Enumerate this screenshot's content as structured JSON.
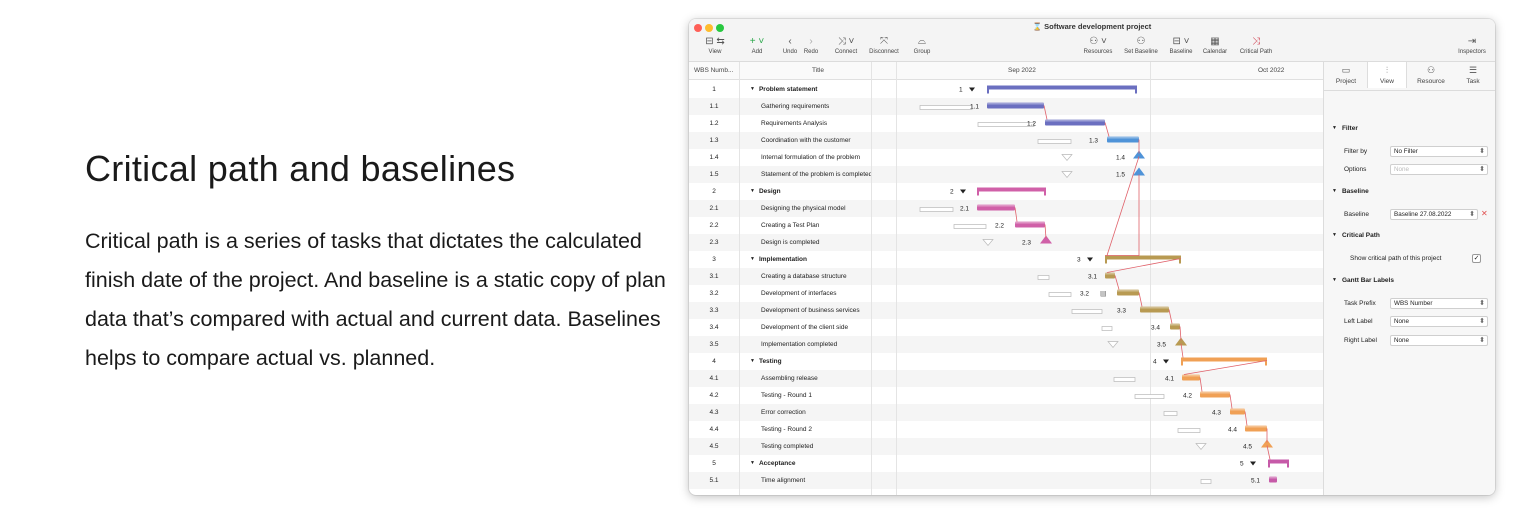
{
  "hero": {
    "title": "Critical path and baselines",
    "body": "Critical path is a series of tasks that dictates the calculated finish date of the project. And baseline is a static copy of plan data that’s compared with actual and current data. Baselines helps to compare actual vs. planned."
  },
  "window": {
    "title": "Software development project",
    "toolbar": {
      "view": "View",
      "add": "Add",
      "undo": "Undo",
      "redo": "Redo",
      "connect": "Connect",
      "disconnect": "Disconnect",
      "group": "Group",
      "resources": "Resources",
      "set_baseline": "Set Baseline",
      "baseline": "Baseline",
      "calendar": "Calendar",
      "critical_path": "Critical Path",
      "inspectors": "Inspectors"
    }
  },
  "grid": {
    "col_wbs": "WBS Numb...",
    "col_title": "Title",
    "months": [
      "Sep 2022",
      "Oct 2022"
    ],
    "rows": [
      {
        "wbs": "1",
        "title": "Problem statement",
        "group": true
      },
      {
        "wbs": "1.1",
        "title": "Gathering requirements",
        "group": false
      },
      {
        "wbs": "1.2",
        "title": "Requirements Analysis",
        "group": false
      },
      {
        "wbs": "1.3",
        "title": "Coordination with the customer",
        "group": false
      },
      {
        "wbs": "1.4",
        "title": "Internal formulation of the problem",
        "group": false
      },
      {
        "wbs": "1.5",
        "title": "Statement of the problem is completed",
        "group": false
      },
      {
        "wbs": "2",
        "title": "Design",
        "group": true
      },
      {
        "wbs": "2.1",
        "title": "Designing the physical model",
        "group": false
      },
      {
        "wbs": "2.2",
        "title": "Creating a Test Plan",
        "group": false
      },
      {
        "wbs": "2.3",
        "title": "Design is completed",
        "group": false
      },
      {
        "wbs": "3",
        "title": "Implementation",
        "group": true
      },
      {
        "wbs": "3.1",
        "title": "Creating a database structure",
        "group": false
      },
      {
        "wbs": "3.2",
        "title": "Development of interfaces",
        "group": false
      },
      {
        "wbs": "3.3",
        "title": "Development of business services",
        "group": false
      },
      {
        "wbs": "3.4",
        "title": "Development of the client side",
        "group": false
      },
      {
        "wbs": "3.5",
        "title": "Implementation completed",
        "group": false
      },
      {
        "wbs": "4",
        "title": "Testing",
        "group": true
      },
      {
        "wbs": "4.1",
        "title": "Assembling release",
        "group": false
      },
      {
        "wbs": "4.2",
        "title": "Testing - Round 1",
        "group": false
      },
      {
        "wbs": "4.3",
        "title": "Error correction",
        "group": false
      },
      {
        "wbs": "4.4",
        "title": "Testing - Round 2",
        "group": false
      },
      {
        "wbs": "4.5",
        "title": "Testing completed",
        "group": false
      },
      {
        "wbs": "5",
        "title": "Acceptance",
        "group": true
      },
      {
        "wbs": "5.1",
        "title": "Time alignment",
        "group": false
      }
    ]
  },
  "inspector": {
    "tabs": [
      "Project",
      "View",
      "Resource",
      "Task"
    ],
    "active_tab": "View",
    "filter": {
      "section": "Filter",
      "filter_by_label": "Filter by",
      "filter_by_value": "No Filter",
      "options_label": "Options",
      "options_value": "None"
    },
    "baseline": {
      "section": "Baseline",
      "label": "Baseline",
      "value": "Baseline 27.08.2022"
    },
    "critical_path": {
      "section": "Critical Path",
      "show_label": "Show critical path of this project",
      "checked": true
    },
    "bar_labels": {
      "section": "Gantt Bar Labels",
      "task_prefix_label": "Task Prefix",
      "task_prefix_value": "WBS Number",
      "left_label": "Left Label",
      "left_value": "None",
      "right_label": "Right Label",
      "right_value": "None"
    }
  },
  "colors": {
    "problem": "#6b6fc0",
    "problem_alt": "#4f93d8",
    "design": "#d060a8",
    "implementation": "#b89a52",
    "testing": "#f0a055",
    "acceptance": "#c65aa8",
    "critical_link": "#e0616a"
  }
}
